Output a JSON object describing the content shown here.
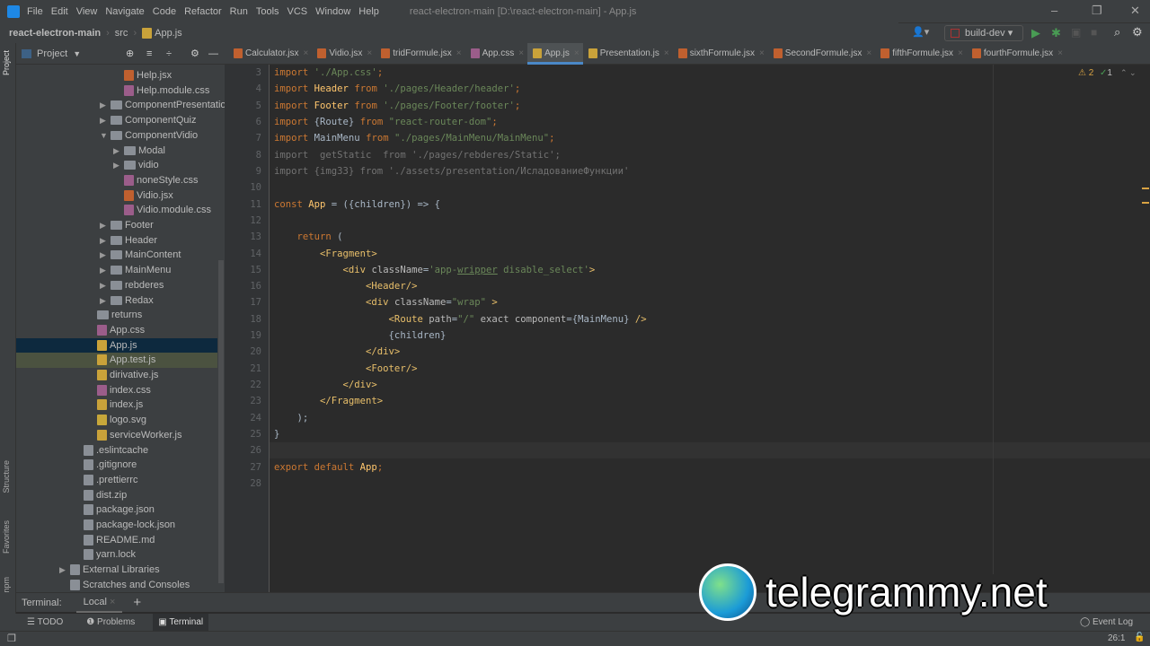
{
  "menubar": {
    "items": [
      "File",
      "Edit",
      "View",
      "Navigate",
      "Code",
      "Refactor",
      "Run",
      "Tools",
      "VCS",
      "Window",
      "Help"
    ],
    "title": "react-electron-main [D:\\react-electron-main] - App.js"
  },
  "navbar": {
    "crumbs": [
      "react-electron-main",
      "src",
      "App.js"
    ],
    "run_config": "build-dev"
  },
  "project": {
    "label": "Project",
    "tree": [
      {
        "t": "Help.jsx",
        "lvl": 4,
        "ic": "jsx"
      },
      {
        "t": "Help.module.css",
        "lvl": 4,
        "ic": "css"
      },
      {
        "t": "ComponentPresentation",
        "lvl": 3,
        "ic": "folder",
        "arrow": "right"
      },
      {
        "t": "ComponentQuiz",
        "lvl": 3,
        "ic": "folder",
        "arrow": "right"
      },
      {
        "t": "ComponentVidio",
        "lvl": 3,
        "ic": "folder",
        "arrow": "down"
      },
      {
        "t": "Modal",
        "lvl": 4,
        "ic": "folder",
        "arrow": "right"
      },
      {
        "t": "vidio",
        "lvl": 4,
        "ic": "folder",
        "arrow": "right"
      },
      {
        "t": "noneStyle.css",
        "lvl": 4,
        "ic": "css"
      },
      {
        "t": "Vidio.jsx",
        "lvl": 4,
        "ic": "jsx"
      },
      {
        "t": "Vidio.module.css",
        "lvl": 4,
        "ic": "css"
      },
      {
        "t": "Footer",
        "lvl": 3,
        "ic": "folder",
        "arrow": "right"
      },
      {
        "t": "Header",
        "lvl": 3,
        "ic": "folder",
        "arrow": "right"
      },
      {
        "t": "MainContent",
        "lvl": 3,
        "ic": "folder",
        "arrow": "right"
      },
      {
        "t": "MainMenu",
        "lvl": 3,
        "ic": "folder",
        "arrow": "right"
      },
      {
        "t": "rebderes",
        "lvl": 3,
        "ic": "folder",
        "arrow": "right"
      },
      {
        "t": "Redax",
        "lvl": 3,
        "ic": "folder",
        "arrow": "right"
      },
      {
        "t": "returns",
        "lvl": 2,
        "ic": "folder"
      },
      {
        "t": "App.css",
        "lvl": 2,
        "ic": "css"
      },
      {
        "t": "App.js",
        "lvl": 2,
        "ic": "js",
        "sel": "sel"
      },
      {
        "t": "App.test.js",
        "lvl": 2,
        "ic": "js",
        "sel": "sel2"
      },
      {
        "t": "dirivative.js",
        "lvl": 2,
        "ic": "js"
      },
      {
        "t": "index.css",
        "lvl": 2,
        "ic": "css"
      },
      {
        "t": "index.js",
        "lvl": 2,
        "ic": "js"
      },
      {
        "t": "logo.svg",
        "lvl": 2,
        "ic": "svg"
      },
      {
        "t": "serviceWorker.js",
        "lvl": 2,
        "ic": "js"
      },
      {
        "t": ".eslintcache",
        "lvl": 1,
        "ic": "gen"
      },
      {
        "t": ".gitignore",
        "lvl": 1,
        "ic": "gen"
      },
      {
        "t": ".prettierrc",
        "lvl": 1,
        "ic": "gen"
      },
      {
        "t": "dist.zip",
        "lvl": 1,
        "ic": "gen"
      },
      {
        "t": "package.json",
        "lvl": 1,
        "ic": "gen"
      },
      {
        "t": "package-lock.json",
        "lvl": 1,
        "ic": "gen"
      },
      {
        "t": "README.md",
        "lvl": 1,
        "ic": "gen"
      },
      {
        "t": "yarn.lock",
        "lvl": 1,
        "ic": "gen"
      },
      {
        "t": "External Libraries",
        "lvl": 0,
        "ic": "gen",
        "arrow": "right"
      },
      {
        "t": "Scratches and Consoles",
        "lvl": 0,
        "ic": "gen"
      }
    ]
  },
  "stripe": {
    "left_top": "Project",
    "structure": "Structure",
    "favorites": "Favorites",
    "npm": "npm"
  },
  "tabs": [
    {
      "t": "Calculator.jsx",
      "ic": "jsx"
    },
    {
      "t": "Vidio.jsx",
      "ic": "jsx"
    },
    {
      "t": "tridFormule.jsx",
      "ic": "jsx"
    },
    {
      "t": "App.css",
      "ic": "css"
    },
    {
      "t": "App.js",
      "ic": "js",
      "active": true
    },
    {
      "t": "Presentation.js",
      "ic": "js"
    },
    {
      "t": "sixthFormule.jsx",
      "ic": "jsx"
    },
    {
      "t": "SecondFormule.jsx",
      "ic": "jsx"
    },
    {
      "t": "fifthFormule.jsx",
      "ic": "jsx"
    },
    {
      "t": "fourthFormule.jsx",
      "ic": "jsx"
    }
  ],
  "inspections": {
    "warnings": "2",
    "ok": "1"
  },
  "code": {
    "first_line": 3,
    "current_line": 26,
    "lines": [
      [
        [
          "import ",
          "kw"
        ],
        [
          "'./App.css'",
          "str"
        ],
        [
          ";",
          "kw"
        ]
      ],
      [
        [
          "import ",
          "kw"
        ],
        [
          "Header ",
          "cls"
        ],
        [
          "from ",
          "kw"
        ],
        [
          "'./pages/Header/header'",
          "str"
        ],
        [
          ";",
          "kw"
        ]
      ],
      [
        [
          "import ",
          "kw"
        ],
        [
          "Footer ",
          "cls"
        ],
        [
          "from ",
          "kw"
        ],
        [
          "'./pages/Footer/footer'",
          "str"
        ],
        [
          ";",
          "kw"
        ]
      ],
      [
        [
          "import ",
          "kw"
        ],
        [
          "{Route} ",
          "id"
        ],
        [
          "from ",
          "kw"
        ],
        [
          "\"react-router-dom\"",
          "str"
        ],
        [
          ";",
          "kw"
        ]
      ],
      [
        [
          "import ",
          "kw"
        ],
        [
          "MainMenu ",
          "id"
        ],
        [
          "from ",
          "kw"
        ],
        [
          "\"./pages/MainMenu/MainMenu\"",
          "str"
        ],
        [
          ";",
          "kw"
        ]
      ],
      [
        [
          "import  getStatic  from './pages/rebderes/Static';",
          "dim"
        ]
      ],
      [
        [
          "import {img33} from './assets/presentation/ИсладованиеФункции'",
          "dim"
        ]
      ],
      [],
      [
        [
          "const ",
          "kw"
        ],
        [
          "App",
          "cls"
        ],
        [
          " = ({children}) => {",
          "id"
        ]
      ],
      [],
      [
        [
          "    return ",
          "kw"
        ],
        [
          "(",
          "id"
        ]
      ],
      [
        [
          "        <Fragment>",
          "tag"
        ]
      ],
      [
        [
          "            <div ",
          "tag"
        ],
        [
          "className",
          "attr"
        ],
        [
          "=",
          "id"
        ],
        [
          "'app-",
          "str"
        ],
        [
          "wripper",
          "und"
        ],
        [
          " disable_select'",
          "str"
        ],
        [
          ">",
          "tag"
        ]
      ],
      [
        [
          "                <Header/>",
          "tag"
        ]
      ],
      [
        [
          "                <div ",
          "tag"
        ],
        [
          "className",
          "attr"
        ],
        [
          "=",
          "id"
        ],
        [
          "\"wrap\" ",
          "str"
        ],
        [
          ">",
          "tag"
        ]
      ],
      [
        [
          "                    <Route ",
          "tag"
        ],
        [
          "path",
          "attr"
        ],
        [
          "=",
          "id"
        ],
        [
          "\"/\" ",
          "str"
        ],
        [
          "exact component",
          "attr"
        ],
        [
          "={MainMenu} ",
          "id"
        ],
        [
          "/>",
          "tag"
        ]
      ],
      [
        [
          "                    {children}",
          "id"
        ]
      ],
      [
        [
          "                </div>",
          "tag"
        ]
      ],
      [
        [
          "                <Footer/>",
          "tag"
        ]
      ],
      [
        [
          "            </div>",
          "tag"
        ]
      ],
      [
        [
          "        </Fragment>",
          "tag"
        ]
      ],
      [
        [
          "    );",
          "id"
        ]
      ],
      [
        [
          "}",
          "id"
        ]
      ],
      [],
      [
        [
          "export default ",
          "kw"
        ],
        [
          "App",
          "cls"
        ],
        [
          ";",
          "kw"
        ]
      ],
      []
    ]
  },
  "terminal": {
    "label": "Terminal:",
    "tab": "Local"
  },
  "toolwindows": [
    "TODO",
    "Problems",
    "Terminal"
  ],
  "status": {
    "event_log": "Event Log",
    "position": "26:1"
  },
  "watermark": "telegrammy.net"
}
